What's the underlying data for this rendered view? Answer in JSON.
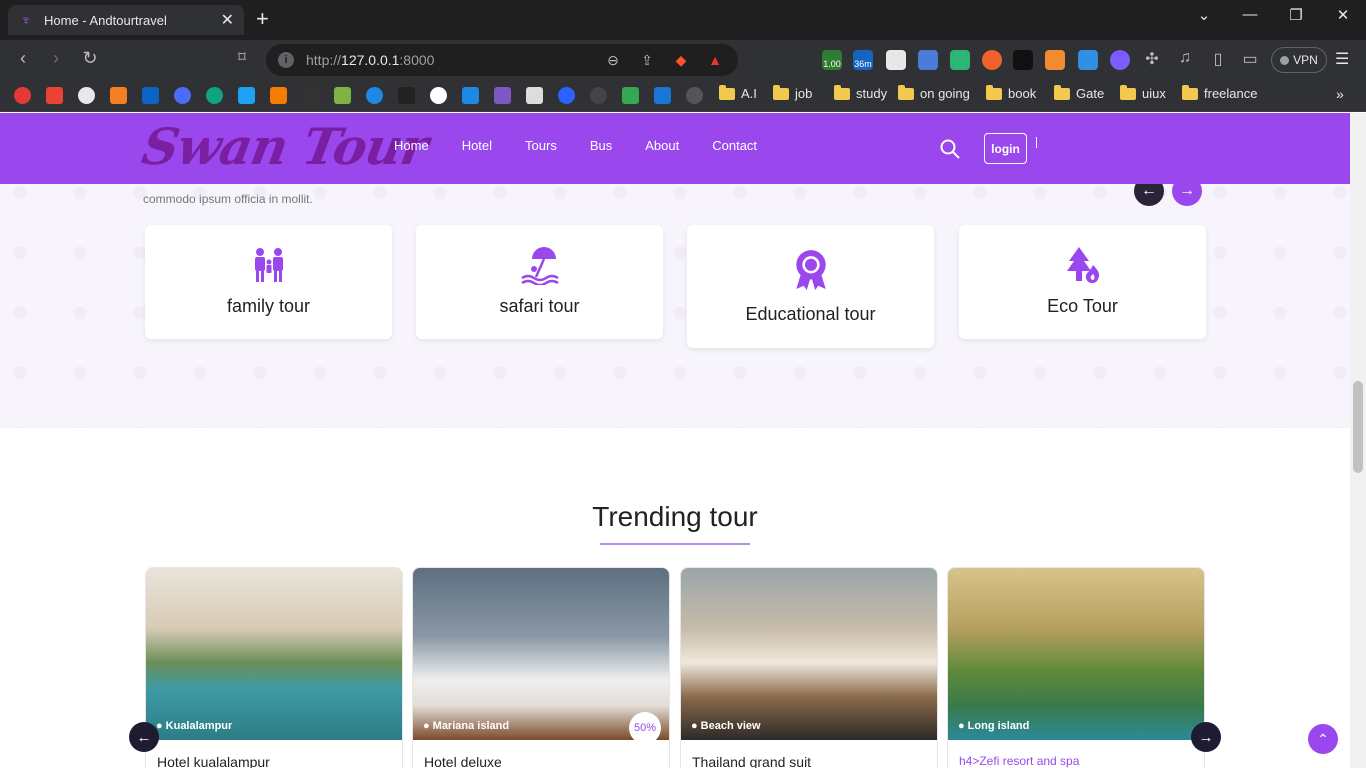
{
  "browser": {
    "tab_title": "Home - Andtourtravel",
    "url_prefix": "http://",
    "url_host": "127.0.0.1",
    "url_port": ":8000",
    "vpn_label": "VPN",
    "ext_badge_1": "1.00",
    "ext_badge_2": "36m",
    "bookmark_folders": [
      "A.I",
      "job",
      "study",
      "on going",
      "book",
      "Gate",
      "uiux",
      "freelance"
    ]
  },
  "site": {
    "logo": "Swan Tour",
    "nav": [
      "Home",
      "Hotel",
      "Tours",
      "Bus",
      "About",
      "Contact"
    ],
    "login_label": "login",
    "intro_text": "commodo ipsum officia in mollit.",
    "categories": [
      {
        "label": "family tour",
        "icon": "family-icon"
      },
      {
        "label": "safari tour",
        "icon": "beach-umbrella-icon"
      },
      {
        "label": "Educational tour",
        "icon": "award-badge-icon"
      },
      {
        "label": "Eco Tour",
        "icon": "tree-fire-icon"
      }
    ],
    "section_title": "Trending tour",
    "tours": [
      {
        "location": "Kualalampur",
        "name": "Hotel kualalampur"
      },
      {
        "location": "Mariana island",
        "name": "Hotel deluxe",
        "badge": "50%"
      },
      {
        "location": "Beach view",
        "name": "Thailand grand suit"
      },
      {
        "location": "Long island",
        "name": "h4>Zefi resort and spa"
      }
    ]
  },
  "colors": {
    "brand": "#9a48ee",
    "dark": "#1f1b33"
  }
}
